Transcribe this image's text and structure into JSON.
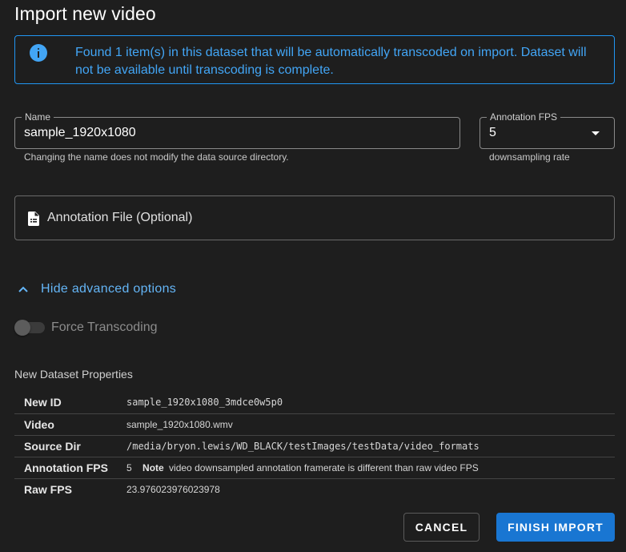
{
  "dialog": {
    "title": "Import new video"
  },
  "alert": {
    "message": "Found 1 item(s) in this dataset that will be automatically transcoded on import. Dataset will not be available until transcoding is complete.",
    "icon": "info-icon",
    "color": "#2196f3"
  },
  "name_field": {
    "label": "Name",
    "value": "sample_1920x1080",
    "hint": "Changing the name does not modify the data source directory."
  },
  "fps_field": {
    "label": "Annotation FPS",
    "value": "5",
    "hint": "downsampling rate"
  },
  "annotation_file": {
    "label": "Annotation File (Optional)",
    "icon": "file-document-icon"
  },
  "advanced": {
    "label": "Hide advanced options",
    "icon": "chevron-up-icon"
  },
  "force_transcoding": {
    "label": "Force Transcoding",
    "enabled": false
  },
  "properties": {
    "title": "New Dataset Properties",
    "rows": [
      {
        "key": "New ID",
        "value": "sample_1920x1080_3mdce0w5p0"
      },
      {
        "key": "Video",
        "value": "sample_1920x1080.wmv"
      },
      {
        "key": "Source Dir",
        "value": "/media/bryon.lewis/WD_BLACK/testImages/testData/video_formats"
      },
      {
        "key": "Annotation FPS",
        "value": "5",
        "note_label": "Note",
        "note": "video downsampled annotation framerate is different than raw video FPS"
      },
      {
        "key": "Raw FPS",
        "value": "23.976023976023978"
      }
    ]
  },
  "buttons": {
    "cancel": "CANCEL",
    "finish": "FINISH IMPORT",
    "primary_color": "#1976d2"
  }
}
